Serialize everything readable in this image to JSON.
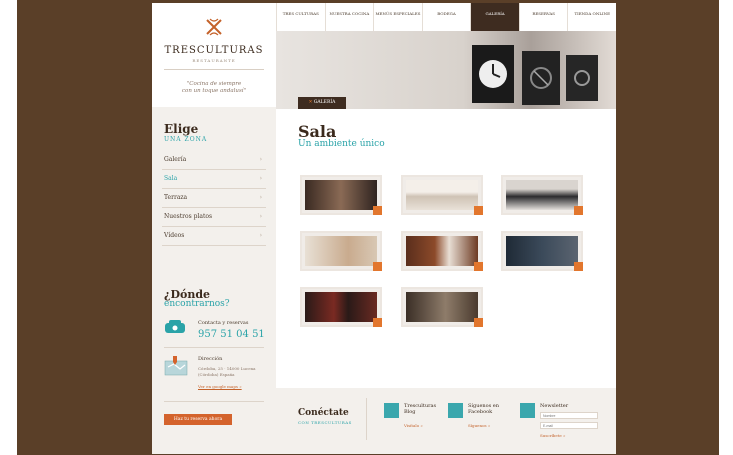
{
  "brand": {
    "title": "TRESCULTURAS",
    "subtitle": "RESTAURANTE",
    "quote_line1": "\"Cocina de siempre",
    "quote_line2": "con un toque andalusí\""
  },
  "nav": {
    "items": [
      {
        "label": "TRES CULTURAS"
      },
      {
        "label": "NUESTRA COCINA"
      },
      {
        "label": "MENÚS ESPECIALES"
      },
      {
        "label": "BODEGA"
      },
      {
        "label": "GALERÍA",
        "active": true
      },
      {
        "label": "RESERVAS"
      },
      {
        "label": "TIENDA ONLINE"
      }
    ]
  },
  "hero": {
    "tag": "GALERÍA"
  },
  "sidebar": {
    "elige_title": "Elige",
    "elige_sub": "UNA ZONA",
    "menu": [
      {
        "label": "Galería"
      },
      {
        "label": "Sala",
        "active": true
      },
      {
        "label": "Terraza"
      },
      {
        "label": "Nuestros platos"
      },
      {
        "label": "Vídeos"
      }
    ],
    "donde_title": "¿Dónde",
    "donde_sub": "encontrarnos?",
    "contact_label": "Contacta y reservas",
    "contact_phone": "957 51 04 51",
    "dir_label": "Dirección",
    "dir_text": "Córdoba, 25 · 14000 Lucena (Córdoba) España",
    "dir_link": "Ver en google maps »",
    "cta": "Haz tu reserva ahora"
  },
  "main": {
    "title": "Sala",
    "subtitle": "Un ambiente único"
  },
  "footer": {
    "title": "Conéctate",
    "subtitle": "CON TRESCULTURAS",
    "blog_title": "Tresculturas Blog",
    "blog_link": "Visítalo »",
    "fb_title": "Síguenos en Facebook",
    "fb_link": "Síguenos »",
    "news_title": "Newsletter",
    "news_name_placeholder": "Nombre",
    "news_email_placeholder": "E-mail",
    "news_link": "Suscríbete »"
  }
}
